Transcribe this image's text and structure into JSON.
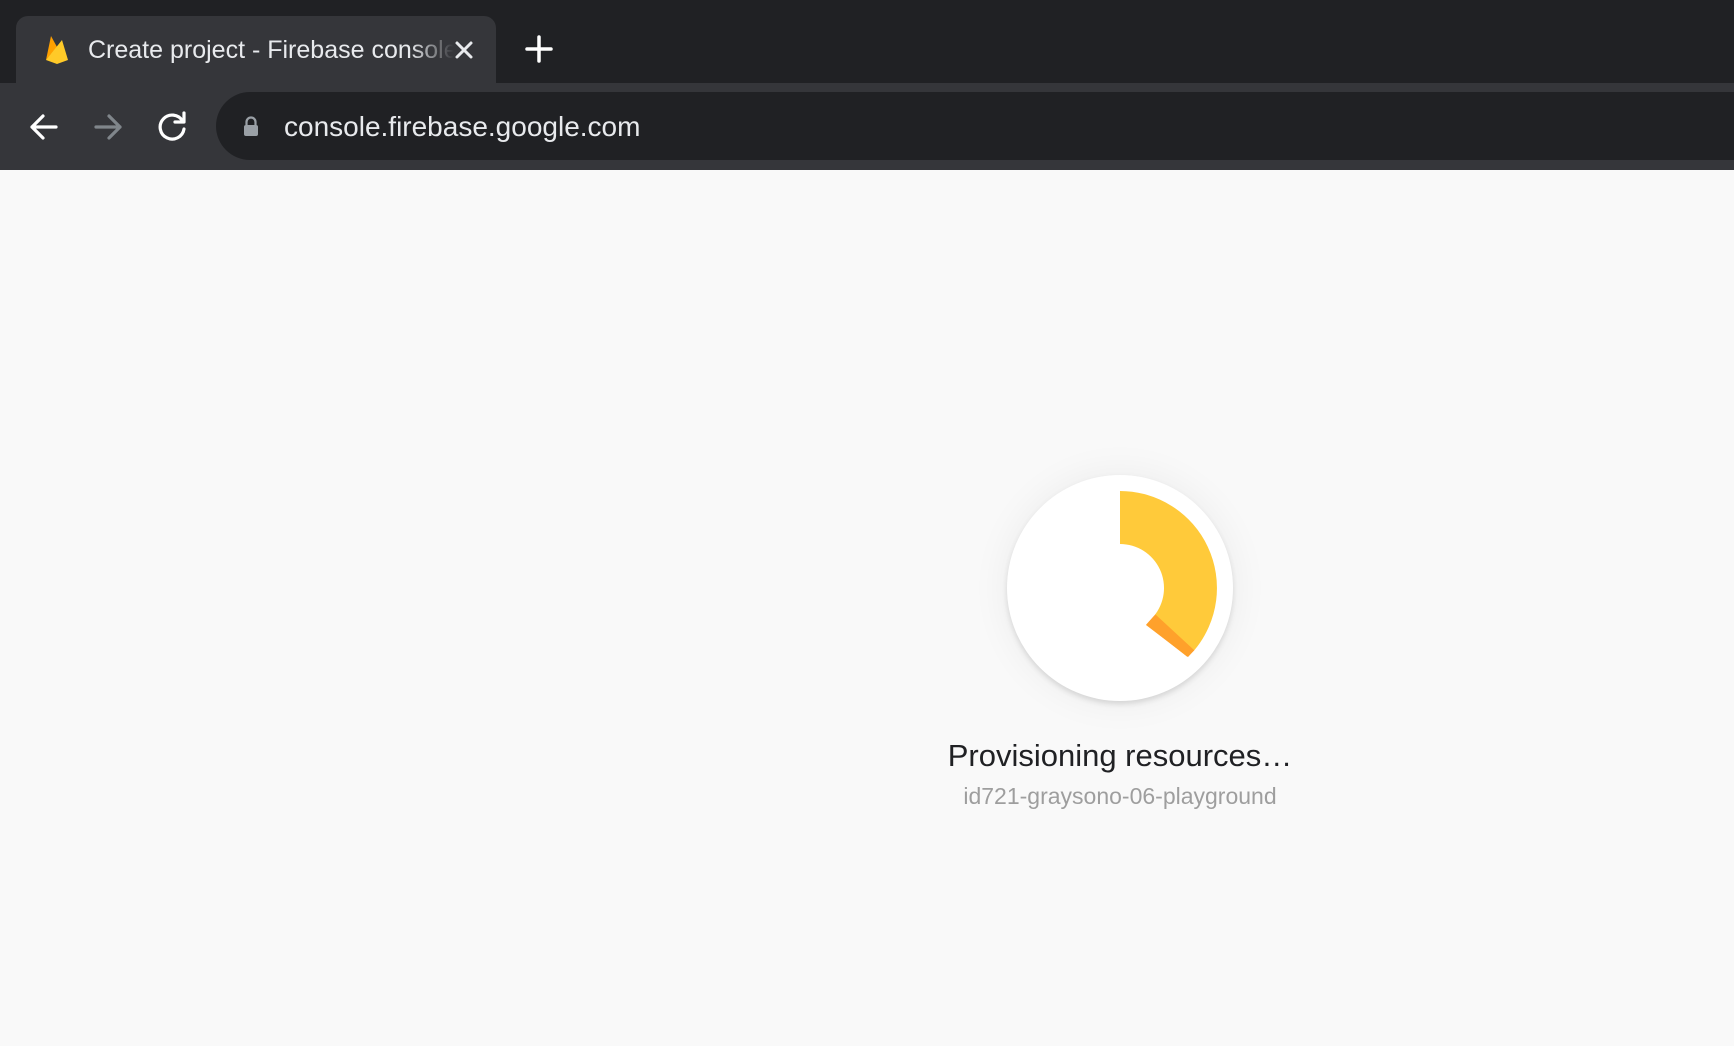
{
  "browser": {
    "tab": {
      "title": "Create project - Firebase console",
      "favicon": "firebase-icon"
    },
    "new_tab_icon": "plus-icon",
    "toolbar": {
      "back_icon": "arrow-left-icon",
      "forward_icon": "arrow-right-icon",
      "reload_icon": "reload-icon",
      "lock_icon": "lock-icon",
      "url": "console.firebase.google.com"
    }
  },
  "main": {
    "status_title": "Provisioning resources…",
    "project_id": "id721-graysono-06-playground",
    "progress_icon": "progress-spinner"
  },
  "colors": {
    "tab_strip": "#202124",
    "toolbar": "#35363a",
    "page_background": "#f9f9f9",
    "spinner_primary": "#ffca3a",
    "spinner_accent": "#ffa12b",
    "status_text": "#202124",
    "secondary_text": "#9e9e9e"
  }
}
